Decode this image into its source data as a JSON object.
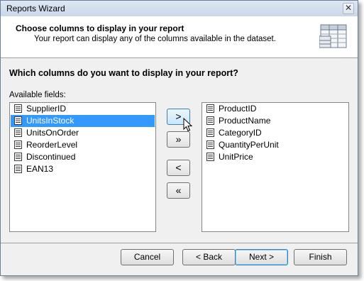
{
  "window": {
    "title": "Reports Wizard",
    "close_symbol": "✕"
  },
  "header": {
    "title": "Choose columns to display in your report",
    "subtitle": "Your report can display any of the columns available in the dataset."
  },
  "question": "Which columns do you want to display in your report?",
  "available": {
    "label": "Available fields:",
    "items": [
      {
        "label": "SupplierID",
        "selected": false
      },
      {
        "label": "UnitsInStock",
        "selected": true
      },
      {
        "label": "UnitsOnOrder",
        "selected": false
      },
      {
        "label": "ReorderLevel",
        "selected": false
      },
      {
        "label": "Discontinued",
        "selected": false
      },
      {
        "label": "EAN13",
        "selected": false
      }
    ]
  },
  "selected_fields": {
    "items": [
      {
        "label": "ProductID"
      },
      {
        "label": "ProductName"
      },
      {
        "label": "CategoryID"
      },
      {
        "label": "QuantityPerUnit"
      },
      {
        "label": "UnitPrice"
      }
    ]
  },
  "move_buttons": {
    "add": ">",
    "add_all": "»",
    "remove": "<",
    "remove_all": "«"
  },
  "footer": {
    "cancel": "Cancel",
    "back": "< Back",
    "next": "Next >",
    "finish": "Finish"
  },
  "icons": {
    "field": "field-icon",
    "wizard": "table-columns-icon",
    "cursor": "mouse-pointer-icon"
  },
  "colors": {
    "selection": "#3399ff",
    "title_gradient_top": "#dfe8f3"
  }
}
